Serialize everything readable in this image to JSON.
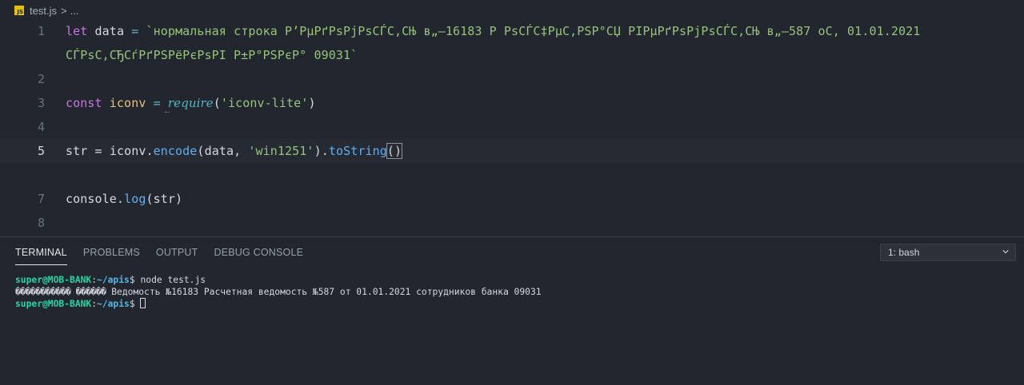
{
  "breadcrumb": {
    "file_icon_text": "JS",
    "file_name": "test.js",
    "separator": ">",
    "more": "..."
  },
  "editor": {
    "lines": [
      {
        "num": "1"
      },
      {
        "num": "2"
      },
      {
        "num": "3"
      },
      {
        "num": "4"
      },
      {
        "num": "5"
      },
      {
        "num": "7"
      },
      {
        "num": "8"
      }
    ],
    "line1": {
      "kw": "let",
      "var": "data",
      "op": "=",
      "string_part1": "`нормальная строка Р’РµРґРѕРјРѕСЃС‚СЊ в„–16183 Р РѕСЃС‡РµС‚РЅР°СЏ РІРµРґРѕРјРѕСЃС‚СЊ в„–587 оС, 01.01.2021",
      "string_part2": "СЃРѕС‚СЂСѓРґРЅРёРєРѕРІ Р±Р°РЅРєР° 09031`"
    },
    "line3": {
      "kw": "const",
      "var": "iconv",
      "op": "=",
      "require": "require",
      "paren_open": "(",
      "arg": "'iconv-lite'",
      "paren_close": ")",
      "hint": "..."
    },
    "line5": {
      "target": "str",
      "op": "=",
      "obj": "iconv",
      "dot": ".",
      "method": "encode",
      "open": "(",
      "arg1": "data",
      "comma": ",",
      "arg2": "'win1251'",
      "close": ")",
      "dot2": ".",
      "method2": "toString",
      "call": "()"
    },
    "line7": {
      "obj": "console",
      "dot": ".",
      "method": "log",
      "open": "(",
      "arg": "str",
      "close": ")"
    }
  },
  "panel": {
    "tabs": [
      {
        "label": "TERMINAL"
      },
      {
        "label": "PROBLEMS"
      },
      {
        "label": "OUTPUT"
      },
      {
        "label": "DEBUG CONSOLE"
      }
    ],
    "terminal_select": "1: bash"
  },
  "terminal": {
    "user_host": "super@MOB-BANK",
    "colon": ":",
    "path": "~/apis",
    "prompt": "$",
    "command": "node test.js",
    "output_garbled": "����������� ������",
    "output_text": "Ведомость №16183 Расчетная ведомость №587 от 01.01.2021 сотрудников банка 09031"
  },
  "colors": {
    "background": "#22262e",
    "keyword": "#c678dd",
    "variable": "#e5c07b",
    "string": "#98c379",
    "function": "#61afef",
    "terminal_user": "#2bd2a2",
    "terminal_path": "#56b6e2"
  },
  "icons": {
    "file": "javascript-file-icon",
    "chevron": "chevron-down-icon"
  }
}
